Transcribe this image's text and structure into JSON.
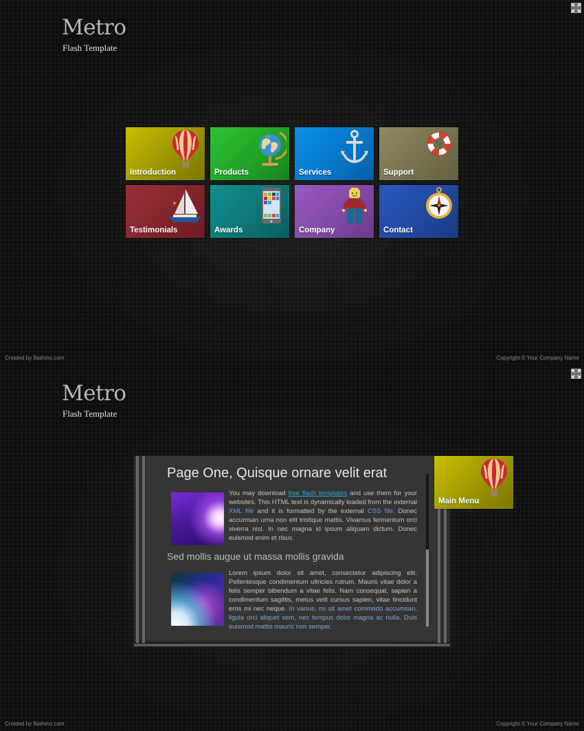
{
  "brand": {
    "title": "Metro",
    "subtitle": "Flash Template"
  },
  "footer": {
    "left": "Created by flashmo.com",
    "right": "Copyright © Your Company Name"
  },
  "controls": {
    "fullscreen_icon": "fullscreen-expand-icon"
  },
  "menu": {
    "tiles": [
      {
        "label": "Introduction",
        "icon": "hot-air-balloon-icon",
        "color": "#b3ab00"
      },
      {
        "label": "Products",
        "icon": "globe-icon",
        "color": "#27b02e"
      },
      {
        "label": "Services",
        "icon": "anchor-icon",
        "color": "#0880d6"
      },
      {
        "label": "Support",
        "icon": "life-buoy-icon",
        "color": "#7f7b55"
      },
      {
        "label": "Testimonials",
        "icon": "sailboat-icon",
        "color": "#8c2a30"
      },
      {
        "label": "Awards",
        "icon": "smartphone-icon",
        "color": "#0f807e"
      },
      {
        "label": "Company",
        "icon": "lego-figure-icon",
        "color": "#8a4fb2"
      },
      {
        "label": "Contact",
        "icon": "compass-icon",
        "color": "#254eae"
      }
    ]
  },
  "page": {
    "main_menu_label": "Main Menu",
    "main_menu_icon": "hot-air-balloon-icon",
    "title": "Page One, Quisque ornare velit erat",
    "section_heading": "Sed mollis augue ut massa mollis gravida",
    "para1": {
      "t1": "You may download ",
      "link1": "free flash templates",
      "t2": " and use them for your websites. This HTML text is dynamically loaded from the external ",
      "link2": "XML file",
      "t3": " and it is formatted by the external ",
      "link3": "CSS file",
      "t4": ". Donec accumsan urna non elit tristique mattis. Vivamus fermentum orci viverra nisl. In nec magna id ipsum aliquam dictum. Donec euismod enim et risus."
    },
    "para2": {
      "t1": " Lorem ipsum dolor sit amet, consectetur adipiscing elit. Pellentesque condimentum ultricies rutrum. Mauris vitae dolor a felis semper bibendum a vitae felis. Nam consequat, sapien a condimentum sagittis, metus velit cursus sapien, vitae tincidunt eros mi nec neque. ",
      "blue": "In varius, mi sit amet commodo accumsan, ligula orci aliquet sem, nec tempus dolor magna ac nulla. Duis euismod mattis mauris non semper."
    },
    "scroll_position_fraction": 0.5
  }
}
